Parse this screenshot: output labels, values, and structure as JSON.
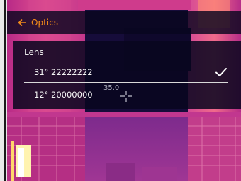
{
  "header": {
    "title": "Optics",
    "back_icon": "arrow-left-icon"
  },
  "lens_panel": {
    "title": "Lens",
    "options": [
      {
        "label": "31° 22222222",
        "selected": true
      },
      {
        "label": "12° 20000000",
        "selected": false
      }
    ]
  },
  "overlay": {
    "measure_value": "35.0",
    "crosshair_icon": "crosshair-icon"
  },
  "colors": {
    "accent": "#f28a1a",
    "panel_bg": "#08061e"
  }
}
